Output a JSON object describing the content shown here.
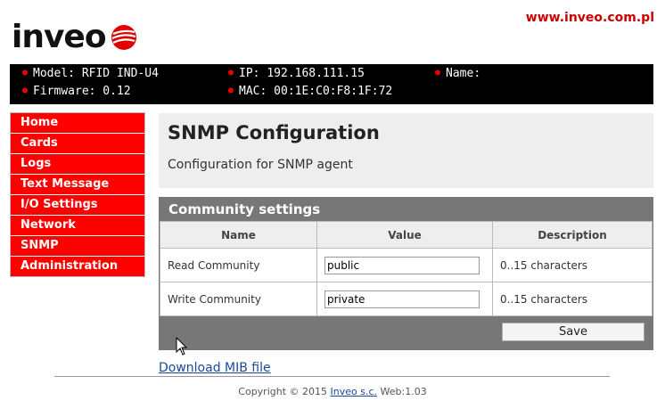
{
  "header": {
    "site_url": "www.inveo.com.pl",
    "logo_text": "inveo"
  },
  "device_info": {
    "model": "Model: RFID IND-U4",
    "firmware": "Firmware: 0.12",
    "ip": "IP: 192.168.111.15",
    "mac": "MAC: 00:1E:C0:F8:1F:72",
    "name": "Name:"
  },
  "sidebar": {
    "items": [
      {
        "label": "Home"
      },
      {
        "label": "Cards"
      },
      {
        "label": "Logs"
      },
      {
        "label": "Text Message"
      },
      {
        "label": "I/O Settings"
      },
      {
        "label": "Network"
      },
      {
        "label": "SNMP"
      },
      {
        "label": "Administration"
      }
    ]
  },
  "main": {
    "title": "SNMP Configuration",
    "description": "Configuration for SNMP agent",
    "section_title": "Community settings",
    "table": {
      "headers": [
        "Name",
        "Value",
        "Description"
      ],
      "rows": [
        {
          "name": "Read Community",
          "value": "public",
          "description": "0..15 characters"
        },
        {
          "name": "Write Community",
          "value": "private",
          "description": "0..15 characters"
        }
      ]
    },
    "save_label": "Save"
  },
  "footer": {
    "download_link": "Download MIB file",
    "copyright_prefix": "Copyright © 2015 ",
    "company_link": "Inveo s.c.",
    "web_version": " Web:1.03"
  },
  "colors": {
    "accent_red": "#ff0000",
    "info_bar": "#000000",
    "panel_gray": "#777777"
  }
}
